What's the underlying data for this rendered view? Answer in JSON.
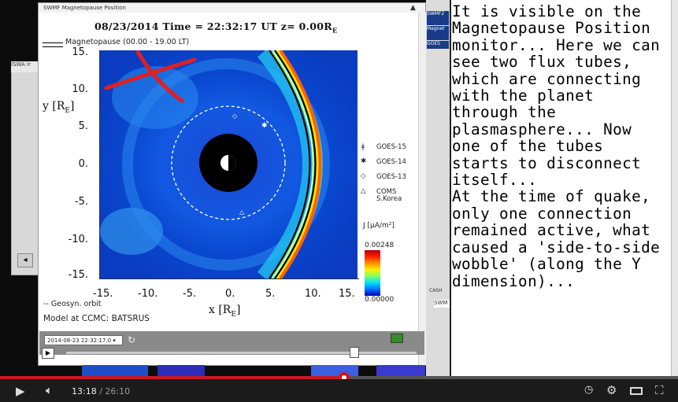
{
  "window": {
    "title": "SWMF Magnetopause Position",
    "close_glyph": "▲"
  },
  "background": {
    "left_window_label": "ISWA Ir",
    "right_thumbs": [
      "SWMF2",
      "Magnet",
      "GOES"
    ],
    "lower_right_labels": [
      "CASH",
      "SWM"
    ]
  },
  "plot": {
    "header": "08/23/2014 Time = 22:32:17 UT z= 0.00R",
    "header_sub": "E",
    "legend": "Magnetopause (00.00 - 19.00 LT)",
    "ylabel": "y [R",
    "ylabel_sub": "E",
    "ylabel_close": "]",
    "xlabel": "x [R",
    "xlabel_sub": "E",
    "xlabel_close": "]",
    "yticks": [
      "15.",
      "10.",
      "5.",
      "0.",
      "-5.",
      "-10.",
      "-15."
    ],
    "xticks": [
      "-15.",
      "-10.",
      "-5.",
      "0.",
      "5.",
      "10.",
      "15."
    ],
    "satellites": [
      "GOES-15",
      "GOES-14",
      "GOES-13",
      "COMS",
      "S.Korea"
    ],
    "colorbar_title": "J [μA/m²]",
    "colorbar_max": "0.00248",
    "colorbar_min": "0.00000",
    "geosyn": "-- Geosyn. orbit",
    "model": "Model at CCMC: BATSRUS"
  },
  "animation": {
    "date_value": "2014-08-23 22:32:17.0",
    "position_fraction": 0.82
  },
  "narrative": "It is visible on the Magnetopause Position monitor... Here we can see two flux tubes, which are connecting with the planet through the plasmasphere... Now one of the tubes starts to disconnect itself...\nAt the time of quake, only one connection remained active, what caused a 'side-to-side wobble' (along the Y dimension)...",
  "player": {
    "current_time": "13:18",
    "total_time": "26:10",
    "time_separator": " / ",
    "progress_fraction": 0.508,
    "accent_color": "#cc181e"
  }
}
